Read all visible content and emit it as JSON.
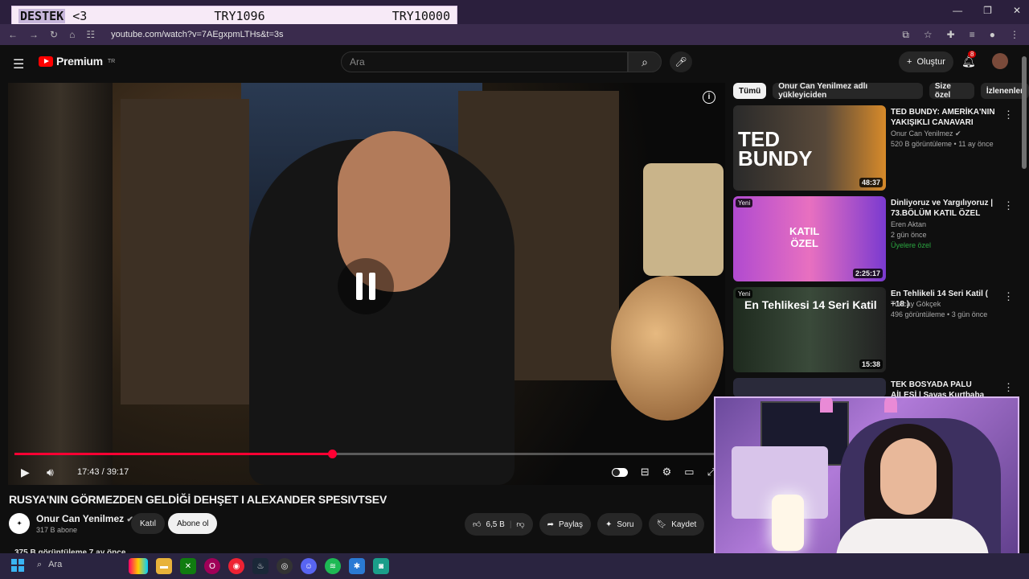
{
  "overlay": {
    "destek": "DESTEK",
    "heart": "<3",
    "current": "TRY1096",
    "goal": "TRY10000"
  },
  "browser": {
    "url": "youtube.com/watch?v=7AEgxpmLTHs&t=3s"
  },
  "header": {
    "logo_text": "Premium",
    "logo_region": "TR",
    "search_placeholder": "Ara",
    "create_label": "Oluştur",
    "notif_count": "8"
  },
  "player": {
    "time": "17:43 / 39:17",
    "progress_fraction": 0.451
  },
  "video": {
    "title": "RUSYA'NIN GÖRMEZDEN GELDİĞİ DEHŞET I ALEXANDER SPESIVTSEV",
    "channel": "Onur Can Yenilmez",
    "subs": "317 B abone",
    "join_label": "Katıl",
    "subscribe_label": "Abone ol",
    "likes": "6,5 B",
    "share_label": "Paylaş",
    "ask_label": "Soru",
    "save_label": "Kaydet",
    "views": "375 B görüntüleme  7 ay önce"
  },
  "chips": [
    "Tümü",
    "Onur Can Yenilmez adlı yükleyiciden",
    "Size özel",
    "İzlenenler"
  ],
  "recommendations": [
    {
      "title": "TED BUNDY: AMERİKA'NIN YAKIŞIKLI CANAVARI",
      "channel": "Onur Can Yenilmez ✔",
      "meta": "520 B görüntüleme • 11 ay önce",
      "duration": "48:37",
      "new": "",
      "extra": ""
    },
    {
      "title": "Dinliyoruz ve Yargılıyoruz | 73.BÖLÜM KATIL ÖZEL",
      "channel": "Eren Aktan",
      "meta": "2 gün önce",
      "duration": "2:25:17",
      "new": "Yeni",
      "extra": "Üyelere özel"
    },
    {
      "title": "En Tehlikeli 14 Seri Katil ( +18 )",
      "channel": "Tuncay Gökçek",
      "meta": "496 görüntüleme • 3 gün önce",
      "duration": "15:38",
      "new": "Yeni",
      "extra": ""
    },
    {
      "title": "TEK BOSYADA PALU AİLESİ | Savaş Kurtbaba ile Suçun ...",
      "channel": "",
      "meta": "",
      "duration": "",
      "new": "",
      "extra": ""
    }
  ],
  "taskbar": {
    "search_label": "Ara"
  }
}
